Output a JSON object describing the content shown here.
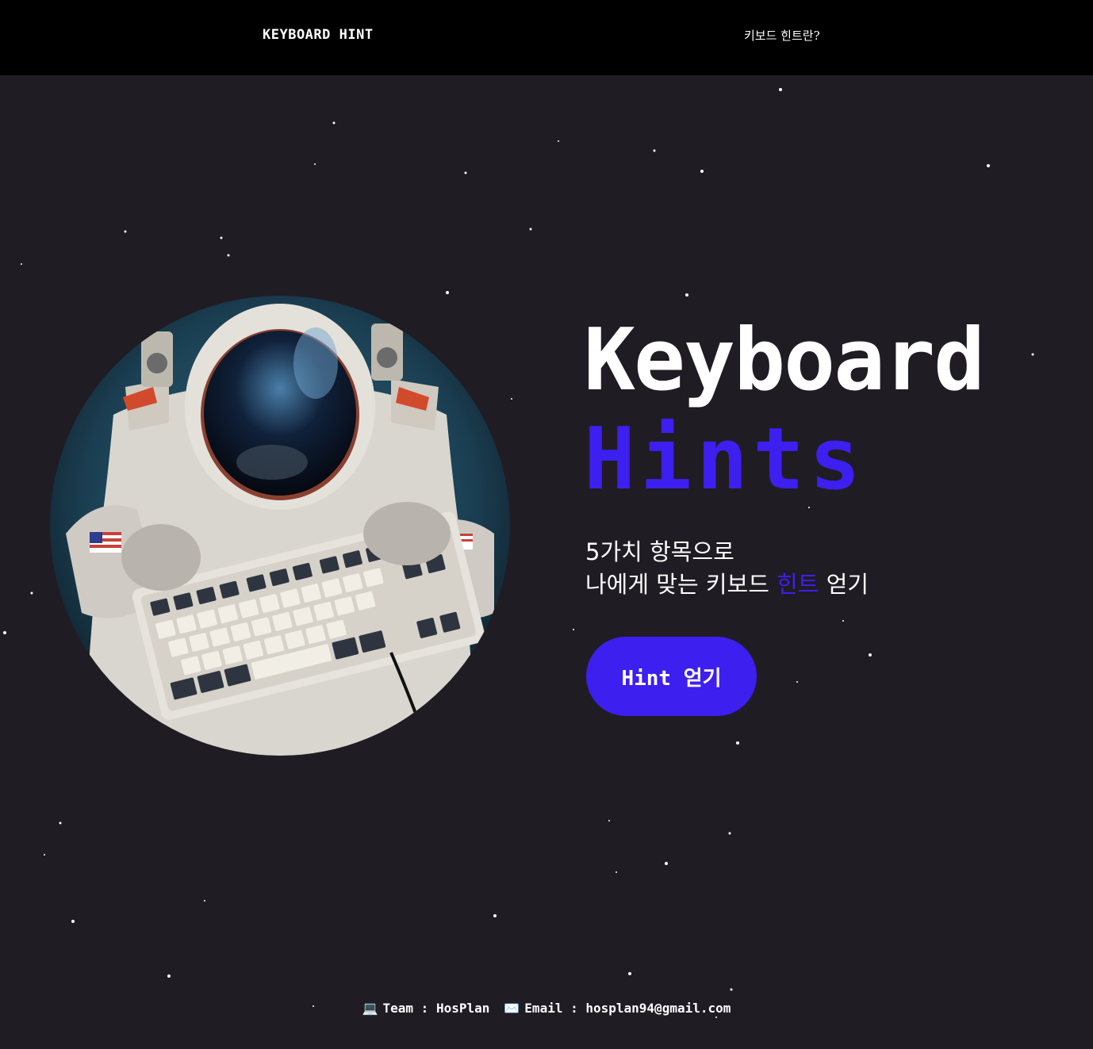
{
  "header": {
    "brand": "KEYBOARD HINT",
    "nav_link": "키보드 힌트란?"
  },
  "hero": {
    "title_line1": "Keyboard",
    "title_line2": "Hints",
    "subtitle_line1": "5가치 항목으로",
    "subtitle_line2_pre": "나에게 맞는 키보드 ",
    "subtitle_line2_highlight": "힌트",
    "subtitle_line2_post": " 얻기",
    "cta_label": "Hint 얻기",
    "image_icon": "astronaut-keyboard-illustration"
  },
  "footer": {
    "team_icon": "laptop-icon",
    "team_text": "Team : HosPlan",
    "email_icon": "envelope-icon",
    "email_text": "Email : hosplan94@gmail.com"
  },
  "colors": {
    "background": "#201c24",
    "header_bg": "#000000",
    "accent": "#3d1ff0",
    "text": "#ffffff"
  }
}
